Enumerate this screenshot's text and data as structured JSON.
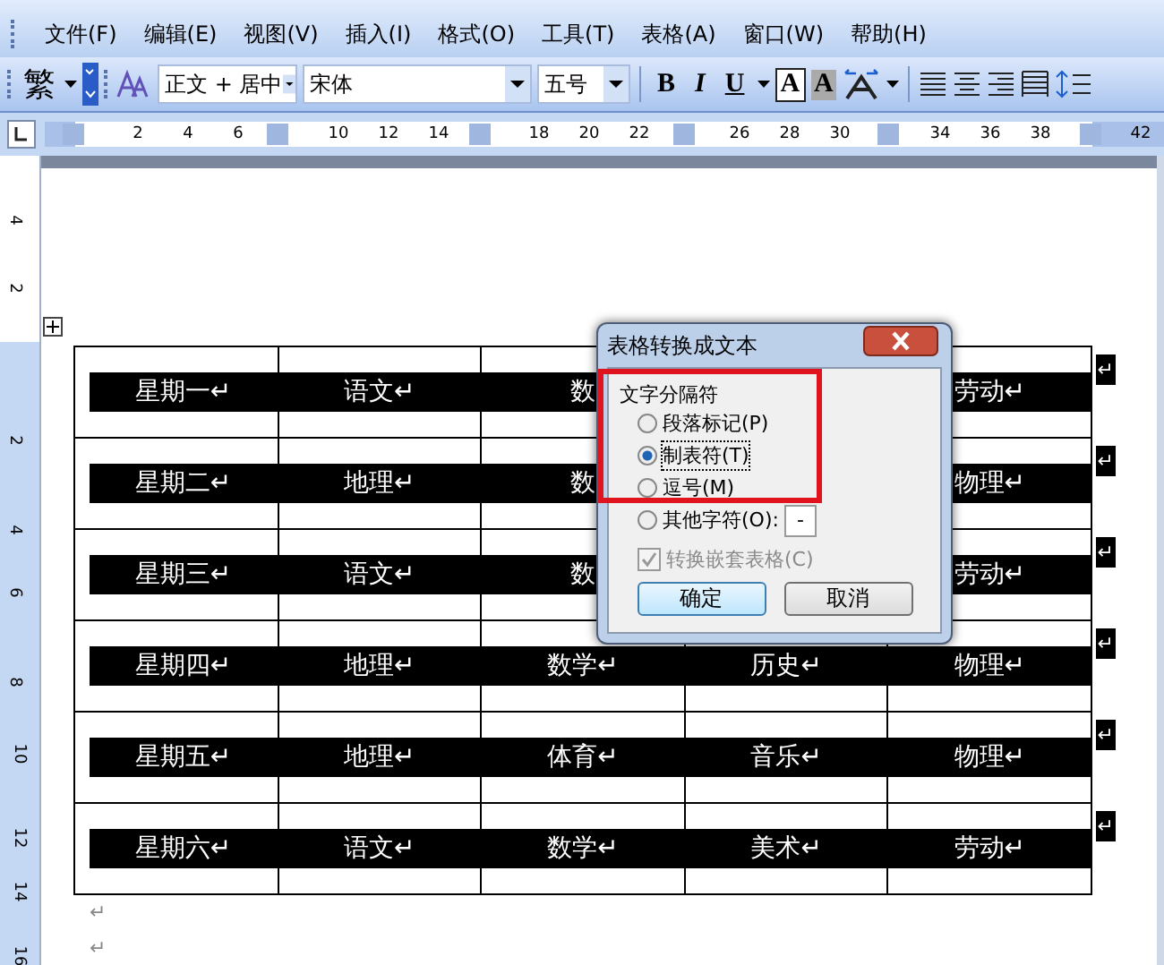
{
  "menu": [
    {
      "label": "文件(F)"
    },
    {
      "label": "编辑(E)"
    },
    {
      "label": "视图(V)"
    },
    {
      "label": "插入(I)"
    },
    {
      "label": "格式(O)"
    },
    {
      "label": "工具(T)"
    },
    {
      "label": "表格(A)"
    },
    {
      "label": "窗口(W)"
    },
    {
      "label": "帮助(H)"
    }
  ],
  "toolbar": {
    "conversion": "繁",
    "style": "正文 + 居中",
    "font": "宋体",
    "size": "五号",
    "bold": "B",
    "italic": "I",
    "underline": "U",
    "border_a": "A",
    "shading_a": "A"
  },
  "ruler": {
    "labels": [
      "2",
      "4",
      "6",
      "10",
      "12",
      "14",
      "18",
      "20",
      "22",
      "26",
      "28",
      "30",
      "34",
      "36",
      "38",
      "42"
    ]
  },
  "vertical_ruler": {
    "labels": [
      "4",
      "2",
      "2",
      "4",
      "6",
      "8",
      "10",
      "12",
      "14",
      "16"
    ]
  },
  "table": {
    "rows": [
      {
        "cells": [
          {
            "text": "星期一↵"
          },
          {
            "text": "语文↵"
          },
          {
            "text": "数"
          },
          {},
          {
            "text": "劳动↵"
          }
        ],
        "end_mark": "↵"
      },
      {
        "cells": [
          {
            "text": "星期二↵"
          },
          {
            "text": "地理↵"
          },
          {
            "text": "数"
          },
          {},
          {
            "text": "物理↵"
          }
        ],
        "end_mark": "↵"
      },
      {
        "cells": [
          {
            "text": "星期三↵"
          },
          {
            "text": "语文↵"
          },
          {
            "text": "数"
          },
          {},
          {
            "text": "劳动↵"
          }
        ],
        "end_mark": "↵"
      },
      {
        "cells": [
          {
            "text": "星期四↵"
          },
          {
            "text": "地理↵"
          },
          {
            "text": "数学↵"
          },
          {
            "text": "历史↵"
          },
          {
            "text": "物理↵"
          }
        ],
        "end_mark": "↵"
      },
      {
        "cells": [
          {
            "text": "星期五↵"
          },
          {
            "text": "地理↵"
          },
          {
            "text": "体育↵"
          },
          {
            "text": "音乐↵"
          },
          {
            "text": "物理↵"
          }
        ],
        "end_mark": "↵"
      },
      {
        "cells": [
          {
            "text": "星期六↵"
          },
          {
            "text": "语文↵"
          },
          {
            "text": "数学↵"
          },
          {
            "text": "美术↵"
          },
          {
            "text": "劳动↵"
          }
        ],
        "end_mark": "↵"
      }
    ]
  },
  "paragraph_marks": [
    "↵",
    "↵"
  ],
  "dialog": {
    "title": "表格转换成文本",
    "group": "文字分隔符",
    "options": [
      {
        "label": "段落标记(P)",
        "selected": false
      },
      {
        "label": "制表符(T)",
        "selected": true
      },
      {
        "label": "逗号(M)",
        "selected": false
      },
      {
        "label": "其他字符(O):",
        "selected": false,
        "value": "-"
      }
    ],
    "nested": {
      "label": "转换嵌套表格(C)",
      "checked": true,
      "disabled": true
    },
    "buttons": [
      "确定",
      "取消"
    ]
  }
}
